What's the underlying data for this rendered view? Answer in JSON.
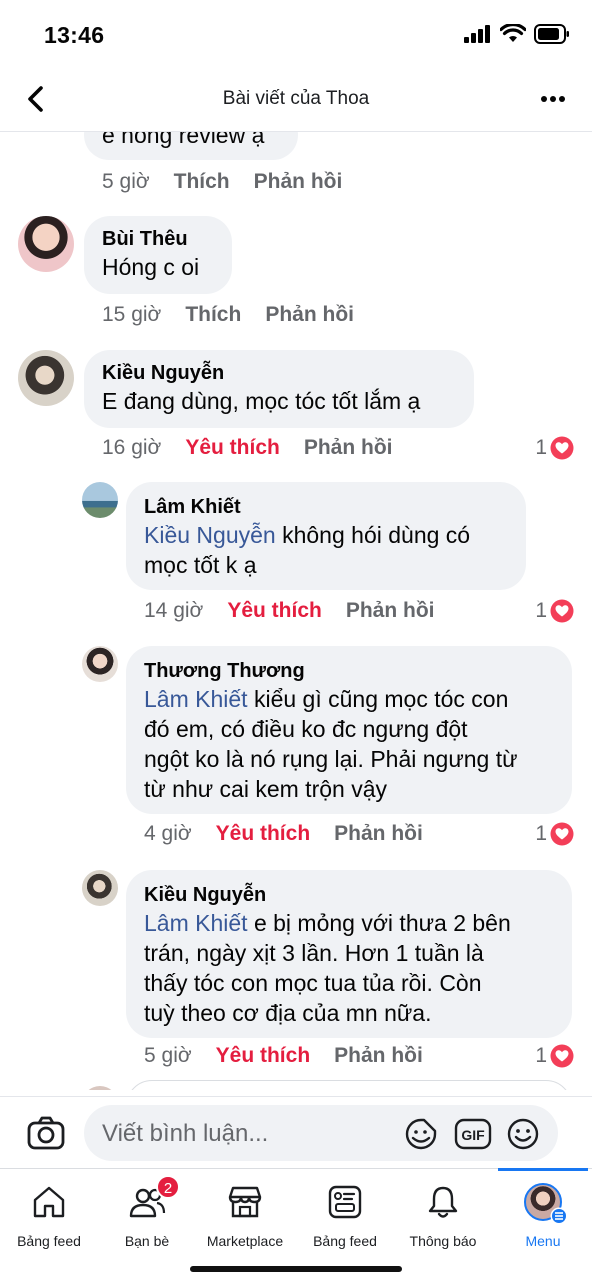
{
  "status_bar": {
    "time": "13:46"
  },
  "header": {
    "title": "Bài viết của Thoa"
  },
  "comments": [
    {
      "text": "e hong review ạ",
      "time": "5 giờ",
      "like": "Thích",
      "reply": "Phản hồi"
    },
    {
      "author": "Bùi Thêu",
      "text": "Hóng  c oi",
      "time": "15 giờ",
      "like": "Thích",
      "reply": "Phản hồi"
    },
    {
      "author": "Kiều Nguyễn",
      "text": "E đang dùng, mọc tóc tốt lắm ạ",
      "time": "16 giờ",
      "like": "Yêu thích",
      "reply": "Phản hồi",
      "reactions": "1"
    }
  ],
  "replies": [
    {
      "author": "Lâm Khiết",
      "mention": "Kiều Nguyễn",
      "line1": " không hói dùng có",
      "line2": "mọc tốt k ạ",
      "time": "14 giờ",
      "like": "Yêu thích",
      "reply": "Phản hồi",
      "reactions": "1"
    },
    {
      "author": "Thương Thương",
      "mention": "Lâm Khiết",
      "line1": " kiểu gì cũng mọc tóc con",
      "line2": "đó em, có điều ko đc ngưng đột",
      "line3": "ngột ko là nó rụng lại. Phải ngưng từ",
      "line4": "từ như cai kem trộn vậy",
      "time": "4 giờ",
      "like": "Yêu thích",
      "reply": "Phản hồi",
      "reactions": "1"
    },
    {
      "author": "Kiều Nguyễn",
      "mention": "Lâm Khiết",
      "line1": " e bị mỏng với thưa 2 bên",
      "line2": "trán, ngày xịt 3 lần. Hơn 1 tuần là",
      "line3": "thấy tóc con mọc tua tủa rồi. Còn",
      "line4": "tuỳ theo cơ địa của mn nữa.",
      "time": "5 giờ",
      "like": "Yêu thích",
      "reply": "Phản hồi",
      "reactions": "1"
    }
  ],
  "composer": {
    "placeholder": "Viết bình luận..."
  },
  "tabbar": {
    "tabs": [
      {
        "label": "Bảng feed"
      },
      {
        "label": "Bạn bè",
        "badge": "2"
      },
      {
        "label": "Marketplace"
      },
      {
        "label": "Bảng feed"
      },
      {
        "label": "Thông báo"
      },
      {
        "label": "Menu"
      }
    ]
  },
  "colors": {
    "accent": "#1877f2",
    "love": "#e41e3f",
    "mention": "#385898",
    "bubble": "#f0f2f5",
    "secondary_text": "#65676b"
  }
}
